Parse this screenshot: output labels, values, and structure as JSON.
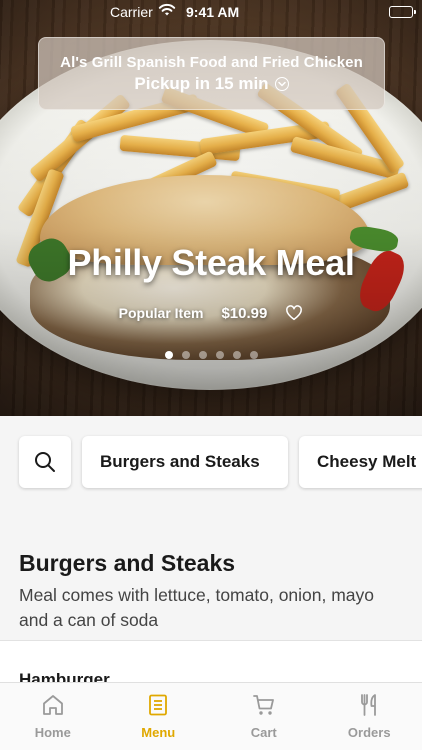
{
  "status_bar": {
    "carrier": "Carrier",
    "time": "9:41 AM"
  },
  "restaurant": {
    "name": "Al's Grill Spanish Food and Fried Chicken",
    "pickup": "Pickup in 15 min"
  },
  "featured": {
    "title": "Philly Steak Meal",
    "tag": "Popular Item",
    "price": "$10.99",
    "carousel_count": 6,
    "carousel_active_index": 0
  },
  "categories": {
    "items": [
      "Burgers and Steaks",
      "Cheesy Melt"
    ]
  },
  "section": {
    "title": "Burgers and Steaks",
    "description": "Meal comes with lettuce, tomato, onion, mayo and a can of soda"
  },
  "menu_items": [
    {
      "name": "Hamburger"
    }
  ],
  "tab_bar": {
    "tabs": [
      {
        "label": "Home",
        "icon": "home-icon"
      },
      {
        "label": "Menu",
        "icon": "menu-icon"
      },
      {
        "label": "Cart",
        "icon": "cart-icon"
      },
      {
        "label": "Orders",
        "icon": "utensils-icon"
      }
    ],
    "active": "Menu",
    "accent_color": "#e0a800",
    "inactive_color": "#9a9a9a"
  }
}
